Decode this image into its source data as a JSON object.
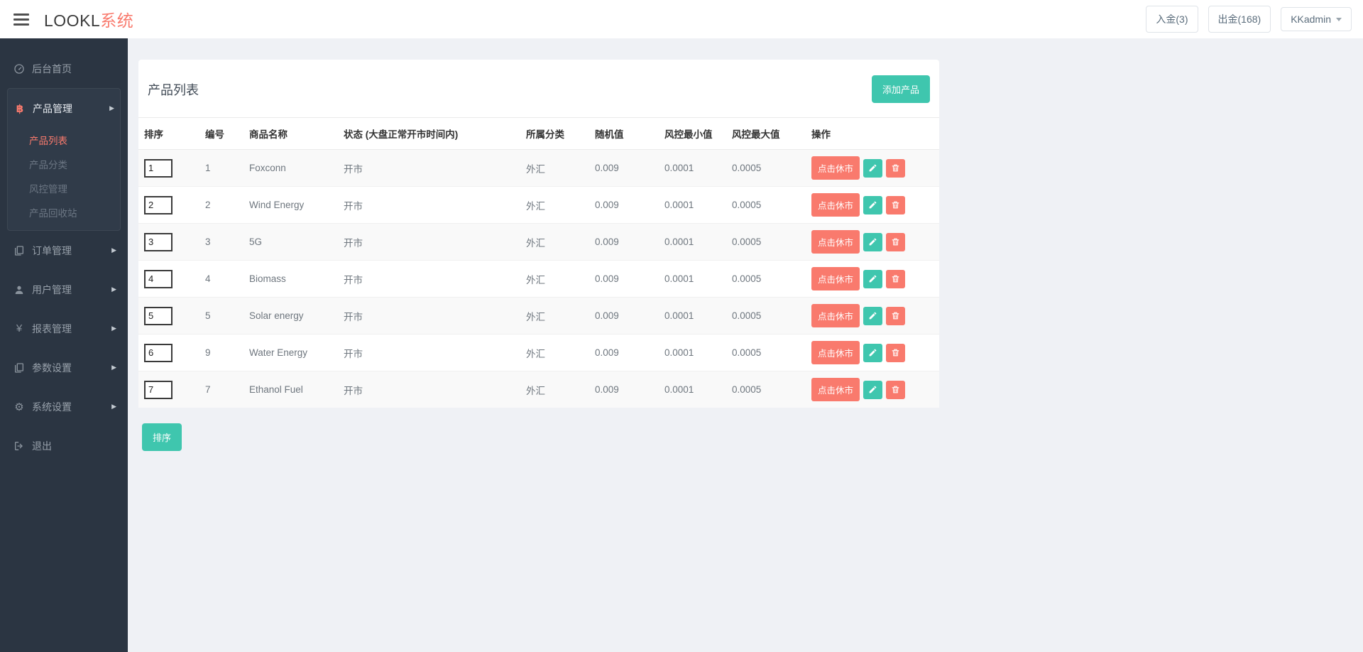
{
  "topbar": {
    "logo_primary": "LOOKL",
    "logo_accent": "系统",
    "deposit_label": "入金(3)",
    "withdraw_label": "出金(168)",
    "user_label": "KKadmin"
  },
  "sidebar": {
    "items": [
      {
        "label": "后台首页",
        "icon": "dashboard-icon",
        "expandable": false
      },
      {
        "label": "产品管理",
        "icon": "bitcoin-icon",
        "expandable": true,
        "expanded": true,
        "children": [
          {
            "label": "产品列表",
            "active": true
          },
          {
            "label": "产品分类",
            "active": false
          },
          {
            "label": "风控管理",
            "active": false
          },
          {
            "label": "产品回收站",
            "active": false
          }
        ]
      },
      {
        "label": "订单管理",
        "icon": "files-icon",
        "expandable": true
      },
      {
        "label": "用户管理",
        "icon": "user-icon",
        "expandable": true
      },
      {
        "label": "报表管理",
        "icon": "yen-icon",
        "expandable": true
      },
      {
        "label": "参数设置",
        "icon": "files-icon",
        "expandable": true
      },
      {
        "label": "系统设置",
        "icon": "gears-icon",
        "expandable": true
      },
      {
        "label": "退出",
        "icon": "signout-icon",
        "expandable": false
      }
    ]
  },
  "main": {
    "card_title": "产品列表",
    "add_button_label": "添加产品",
    "sort_button_label": "排序",
    "table": {
      "headers": [
        "排序",
        "编号",
        "商品名称",
        "状态 (大盘正常开市时间内)",
        "所属分类",
        "随机值",
        "风控最小值",
        "风控最大值",
        "操作"
      ],
      "action_close_label": "点击休市",
      "rows": [
        {
          "sort": "1",
          "id": "1",
          "name": "Foxconn",
          "status": "开市",
          "category": "外汇",
          "random": "0.009",
          "risk_min": "0.0001",
          "risk_max": "0.0005"
        },
        {
          "sort": "2",
          "id": "2",
          "name": "Wind Energy",
          "status": "开市",
          "category": "外汇",
          "random": "0.009",
          "risk_min": "0.0001",
          "risk_max": "0.0005"
        },
        {
          "sort": "3",
          "id": "3",
          "name": "5G",
          "status": "开市",
          "category": "外汇",
          "random": "0.009",
          "risk_min": "0.0001",
          "risk_max": "0.0005"
        },
        {
          "sort": "4",
          "id": "4",
          "name": "Biomass",
          "status": "开市",
          "category": "外汇",
          "random": "0.009",
          "risk_min": "0.0001",
          "risk_max": "0.0005"
        },
        {
          "sort": "5",
          "id": "5",
          "name": "Solar energy",
          "status": "开市",
          "category": "外汇",
          "random": "0.009",
          "risk_min": "0.0001",
          "risk_max": "0.0005"
        },
        {
          "sort": "6",
          "id": "9",
          "name": "Water Energy",
          "status": "开市",
          "category": "外汇",
          "random": "0.009",
          "risk_min": "0.0001",
          "risk_max": "0.0005"
        },
        {
          "sort": "7",
          "id": "7",
          "name": "Ethanol Fuel",
          "status": "开市",
          "category": "外汇",
          "random": "0.009",
          "risk_min": "0.0001",
          "risk_max": "0.0005"
        }
      ]
    }
  },
  "colors": {
    "accent_teal": "#3fc6ae",
    "accent_salmon": "#f97a6d",
    "sidebar_bg": "#2b3542",
    "page_bg": "#eff1f5"
  }
}
